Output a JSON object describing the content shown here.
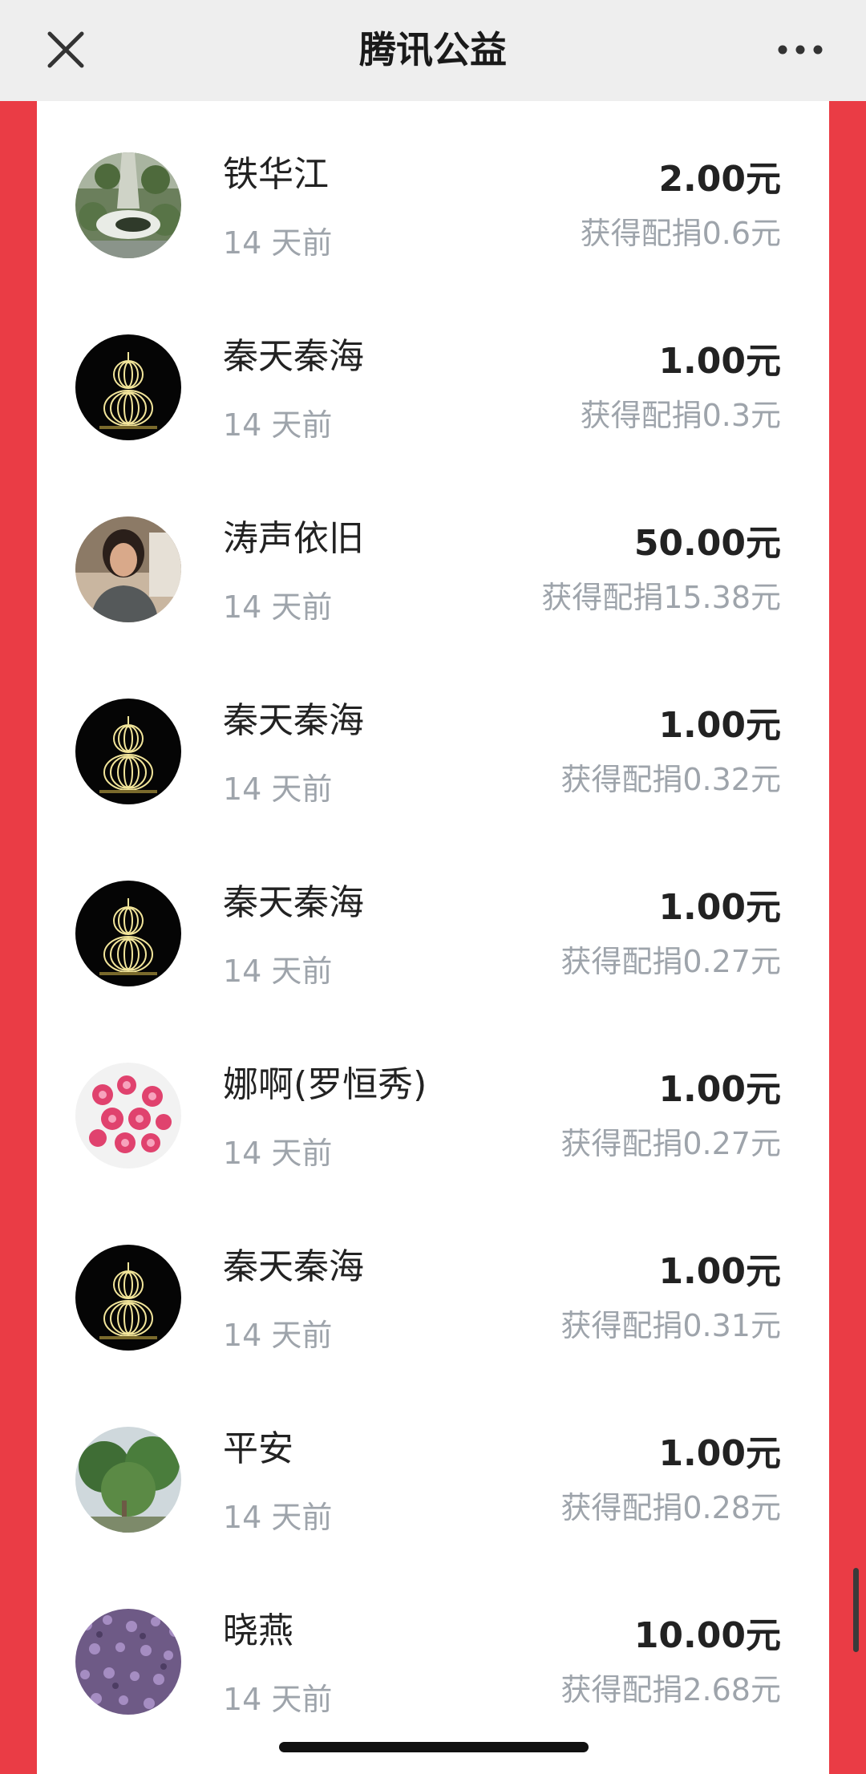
{
  "nav": {
    "title": "腾讯公益",
    "close_icon": "close-icon",
    "more_icon": "more-icon"
  },
  "colors": {
    "accent_red": "#ea3c45",
    "header_bg": "#eeeeee",
    "text_primary": "#222222",
    "text_secondary": "#9ea4ab"
  },
  "donors": [
    {
      "name": "铁华江",
      "time": "14 天前",
      "amount": "2.00元",
      "match": "获得配捐0.6元",
      "avatar": "park-aerial"
    },
    {
      "name": "秦天秦海",
      "time": "14 天前",
      "amount": "1.00元",
      "match": "获得配捐0.3元",
      "avatar": "gourd-lights"
    },
    {
      "name": "涛声依旧",
      "time": "14 天前",
      "amount": "50.00元",
      "match": "获得配捐15.38元",
      "avatar": "woman-portrait"
    },
    {
      "name": "秦天秦海",
      "time": "14 天前",
      "amount": "1.00元",
      "match": "获得配捐0.32元",
      "avatar": "gourd-lights"
    },
    {
      "name": "秦天秦海",
      "time": "14 天前",
      "amount": "1.00元",
      "match": "获得配捐0.27元",
      "avatar": "gourd-lights"
    },
    {
      "name": "娜啊(罗恒秀)",
      "time": "14 天前",
      "amount": "1.00元",
      "match": "获得配捐0.27元",
      "avatar": "pink-roses"
    },
    {
      "name": "秦天秦海",
      "time": "14 天前",
      "amount": "1.00元",
      "match": "获得配捐0.31元",
      "avatar": "gourd-lights"
    },
    {
      "name": "平安",
      "time": "14 天前",
      "amount": "1.00元",
      "match": "获得配捐0.28元",
      "avatar": "trees"
    },
    {
      "name": "晓燕",
      "time": "14 天前",
      "amount": "10.00元",
      "match": "获得配捐2.68元",
      "avatar": "purple-flowers"
    }
  ]
}
